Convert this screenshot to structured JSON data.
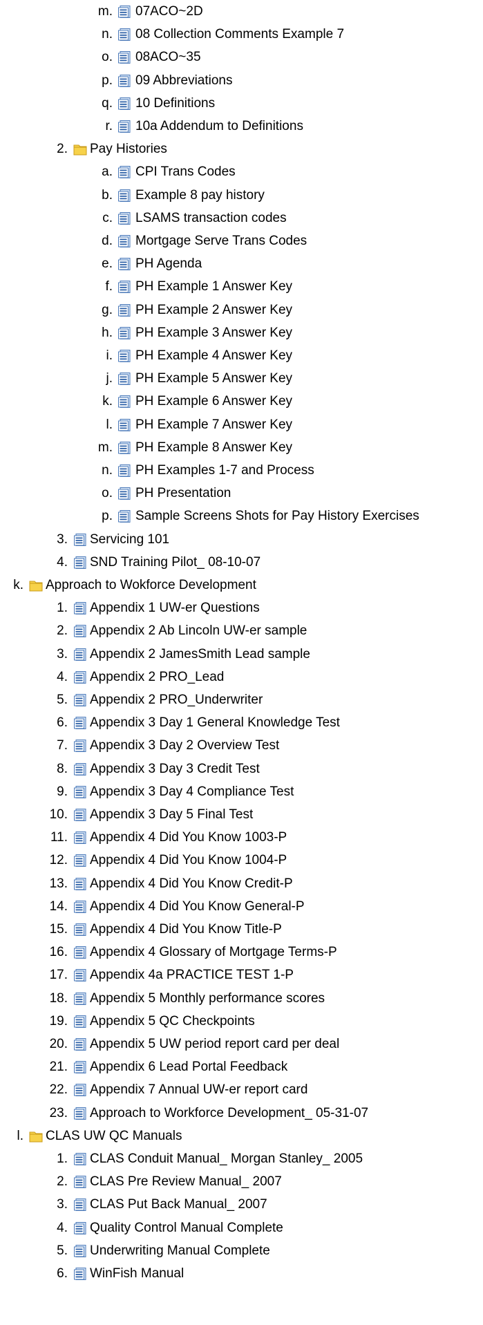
{
  "outline": [
    {
      "marker": "m.",
      "label": "07ACO~2D",
      "icon": "document-icon",
      "level": 2
    },
    {
      "marker": "n.",
      "label": "08 Collection Comments Example 7",
      "icon": "document-icon",
      "level": 2
    },
    {
      "marker": "o.",
      "label": "08ACO~35",
      "icon": "document-icon",
      "level": 2
    },
    {
      "marker": "p.",
      "label": "09 Abbreviations",
      "icon": "document-icon",
      "level": 2
    },
    {
      "marker": "q.",
      "label": "10 Definitions",
      "icon": "document-icon",
      "level": 2
    },
    {
      "marker": "r.",
      "label": "10a Addendum to Definitions",
      "icon": "document-icon",
      "level": 2
    },
    {
      "marker": "2.",
      "label": "Pay Histories",
      "icon": "folder-icon",
      "level": 1
    },
    {
      "marker": "a.",
      "label": "CPI Trans Codes",
      "icon": "document-icon",
      "level": 2
    },
    {
      "marker": "b.",
      "label": "Example 8 pay history",
      "icon": "document-icon",
      "level": 2
    },
    {
      "marker": "c.",
      "label": "LSAMS transaction codes",
      "icon": "document-icon",
      "level": 2
    },
    {
      "marker": "d.",
      "label": "Mortgage Serve Trans Codes",
      "icon": "document-icon",
      "level": 2
    },
    {
      "marker": "e.",
      "label": "PH Agenda",
      "icon": "document-icon",
      "level": 2
    },
    {
      "marker": "f.",
      "label": "PH Example 1 Answer Key",
      "icon": "document-icon",
      "level": 2
    },
    {
      "marker": "g.",
      "label": "PH Example 2 Answer Key",
      "icon": "document-icon",
      "level": 2
    },
    {
      "marker": "h.",
      "label": "PH Example 3 Answer Key",
      "icon": "document-icon",
      "level": 2
    },
    {
      "marker": "i.",
      "label": "PH Example 4 Answer Key",
      "icon": "document-icon",
      "level": 2
    },
    {
      "marker": "j.",
      "label": "PH Example 5 Answer Key",
      "icon": "document-icon",
      "level": 2
    },
    {
      "marker": "k.",
      "label": "PH Example 6 Answer Key",
      "icon": "document-icon",
      "level": 2
    },
    {
      "marker": "l.",
      "label": "PH Example 7 Answer Key",
      "icon": "document-icon",
      "level": 2
    },
    {
      "marker": "m.",
      "label": "PH Example 8 Answer Key",
      "icon": "document-icon",
      "level": 2
    },
    {
      "marker": "n.",
      "label": "PH Examples 1-7 and Process",
      "icon": "document-icon",
      "level": 2
    },
    {
      "marker": "o.",
      "label": "PH Presentation",
      "icon": "document-icon",
      "level": 2
    },
    {
      "marker": "p.",
      "label": "Sample Screens Shots for Pay History Exercises",
      "icon": "document-icon",
      "level": 2
    },
    {
      "marker": "3.",
      "label": "Servicing 101",
      "icon": "document-icon",
      "level": 1
    },
    {
      "marker": "4.",
      "label": "SND Training Pilot_ 08-10-07",
      "icon": "document-icon",
      "level": 1
    },
    {
      "marker": "k.",
      "label": "Approach to Wokforce Development",
      "icon": "folder-icon",
      "level": 0
    },
    {
      "marker": "1.",
      "label": "Appendix 1 UW-er Questions",
      "icon": "document-icon",
      "level": 1
    },
    {
      "marker": "2.",
      "label": "Appendix 2 Ab Lincoln UW-er sample",
      "icon": "document-icon",
      "level": 1
    },
    {
      "marker": "3.",
      "label": "Appendix 2 JamesSmith Lead sample",
      "icon": "document-icon",
      "level": 1
    },
    {
      "marker": "4.",
      "label": "Appendix 2 PRO_Lead",
      "icon": "document-icon",
      "level": 1
    },
    {
      "marker": "5.",
      "label": "Appendix 2 PRO_Underwriter",
      "icon": "document-icon",
      "level": 1
    },
    {
      "marker": "6.",
      "label": "Appendix 3 Day 1 General Knowledge Test",
      "icon": "document-icon",
      "level": 1
    },
    {
      "marker": "7.",
      "label": "Appendix 3 Day 2 Overview Test",
      "icon": "document-icon",
      "level": 1
    },
    {
      "marker": "8.",
      "label": "Appendix 3 Day 3 Credit Test",
      "icon": "document-icon",
      "level": 1
    },
    {
      "marker": "9.",
      "label": "Appendix 3 Day 4 Compliance Test",
      "icon": "document-icon",
      "level": 1
    },
    {
      "marker": "10.",
      "label": "Appendix 3 Day 5 Final Test",
      "icon": "document-icon",
      "level": 1
    },
    {
      "marker": "11.",
      "label": "Appendix 4 Did You Know 1003-P",
      "icon": "document-icon",
      "level": 1
    },
    {
      "marker": "12.",
      "label": "Appendix 4 Did You Know 1004-P",
      "icon": "document-icon",
      "level": 1
    },
    {
      "marker": "13.",
      "label": "Appendix 4 Did You Know Credit-P",
      "icon": "document-icon",
      "level": 1
    },
    {
      "marker": "14.",
      "label": "Appendix 4 Did You Know General-P",
      "icon": "document-icon",
      "level": 1
    },
    {
      "marker": "15.",
      "label": "Appendix 4 Did You Know Title-P",
      "icon": "document-icon",
      "level": 1
    },
    {
      "marker": "16.",
      "label": "Appendix 4 Glossary of Mortgage Terms-P",
      "icon": "document-icon",
      "level": 1
    },
    {
      "marker": "17.",
      "label": "Appendix 4a PRACTICE TEST 1-P",
      "icon": "document-icon",
      "level": 1
    },
    {
      "marker": "18.",
      "label": "Appendix 5 Monthly performance scores",
      "icon": "document-icon",
      "level": 1
    },
    {
      "marker": "19.",
      "label": "Appendix 5 QC Checkpoints",
      "icon": "document-icon",
      "level": 1
    },
    {
      "marker": "20.",
      "label": "Appendix 5 UW period report card per deal",
      "icon": "document-icon",
      "level": 1
    },
    {
      "marker": "21.",
      "label": "Appendix 6 Lead Portal Feedback",
      "icon": "document-icon",
      "level": 1
    },
    {
      "marker": "22.",
      "label": "Appendix 7 Annual UW-er report card",
      "icon": "document-icon",
      "level": 1
    },
    {
      "marker": "23.",
      "label": "Approach to Workforce Development_ 05-31-07",
      "icon": "document-icon",
      "level": 1
    },
    {
      "marker": "l.",
      "label": "CLAS UW QC Manuals",
      "icon": "folder-icon",
      "level": 0
    },
    {
      "marker": "1.",
      "label": "CLAS Conduit Manual_ Morgan Stanley_ 2005",
      "icon": "document-icon",
      "level": 1
    },
    {
      "marker": "2.",
      "label": "CLAS Pre Review Manual_ 2007",
      "icon": "document-icon",
      "level": 1
    },
    {
      "marker": "3.",
      "label": "CLAS Put Back Manual_ 2007",
      "icon": "document-icon",
      "level": 1
    },
    {
      "marker": "4.",
      "label": "Quality Control Manual Complete",
      "icon": "document-icon",
      "level": 1
    },
    {
      "marker": "5.",
      "label": "Underwriting Manual Complete",
      "icon": "document-icon",
      "level": 1
    },
    {
      "marker": "6.",
      "label": "WinFish Manual",
      "icon": "document-icon",
      "level": 1
    }
  ],
  "colors": {
    "folder_fill": "#f7d24a",
    "folder_stroke": "#c89b1a",
    "doc_fill": "#dbe8f7",
    "doc_stroke": "#4a78b8",
    "doc_lines": "#2f62a8"
  }
}
